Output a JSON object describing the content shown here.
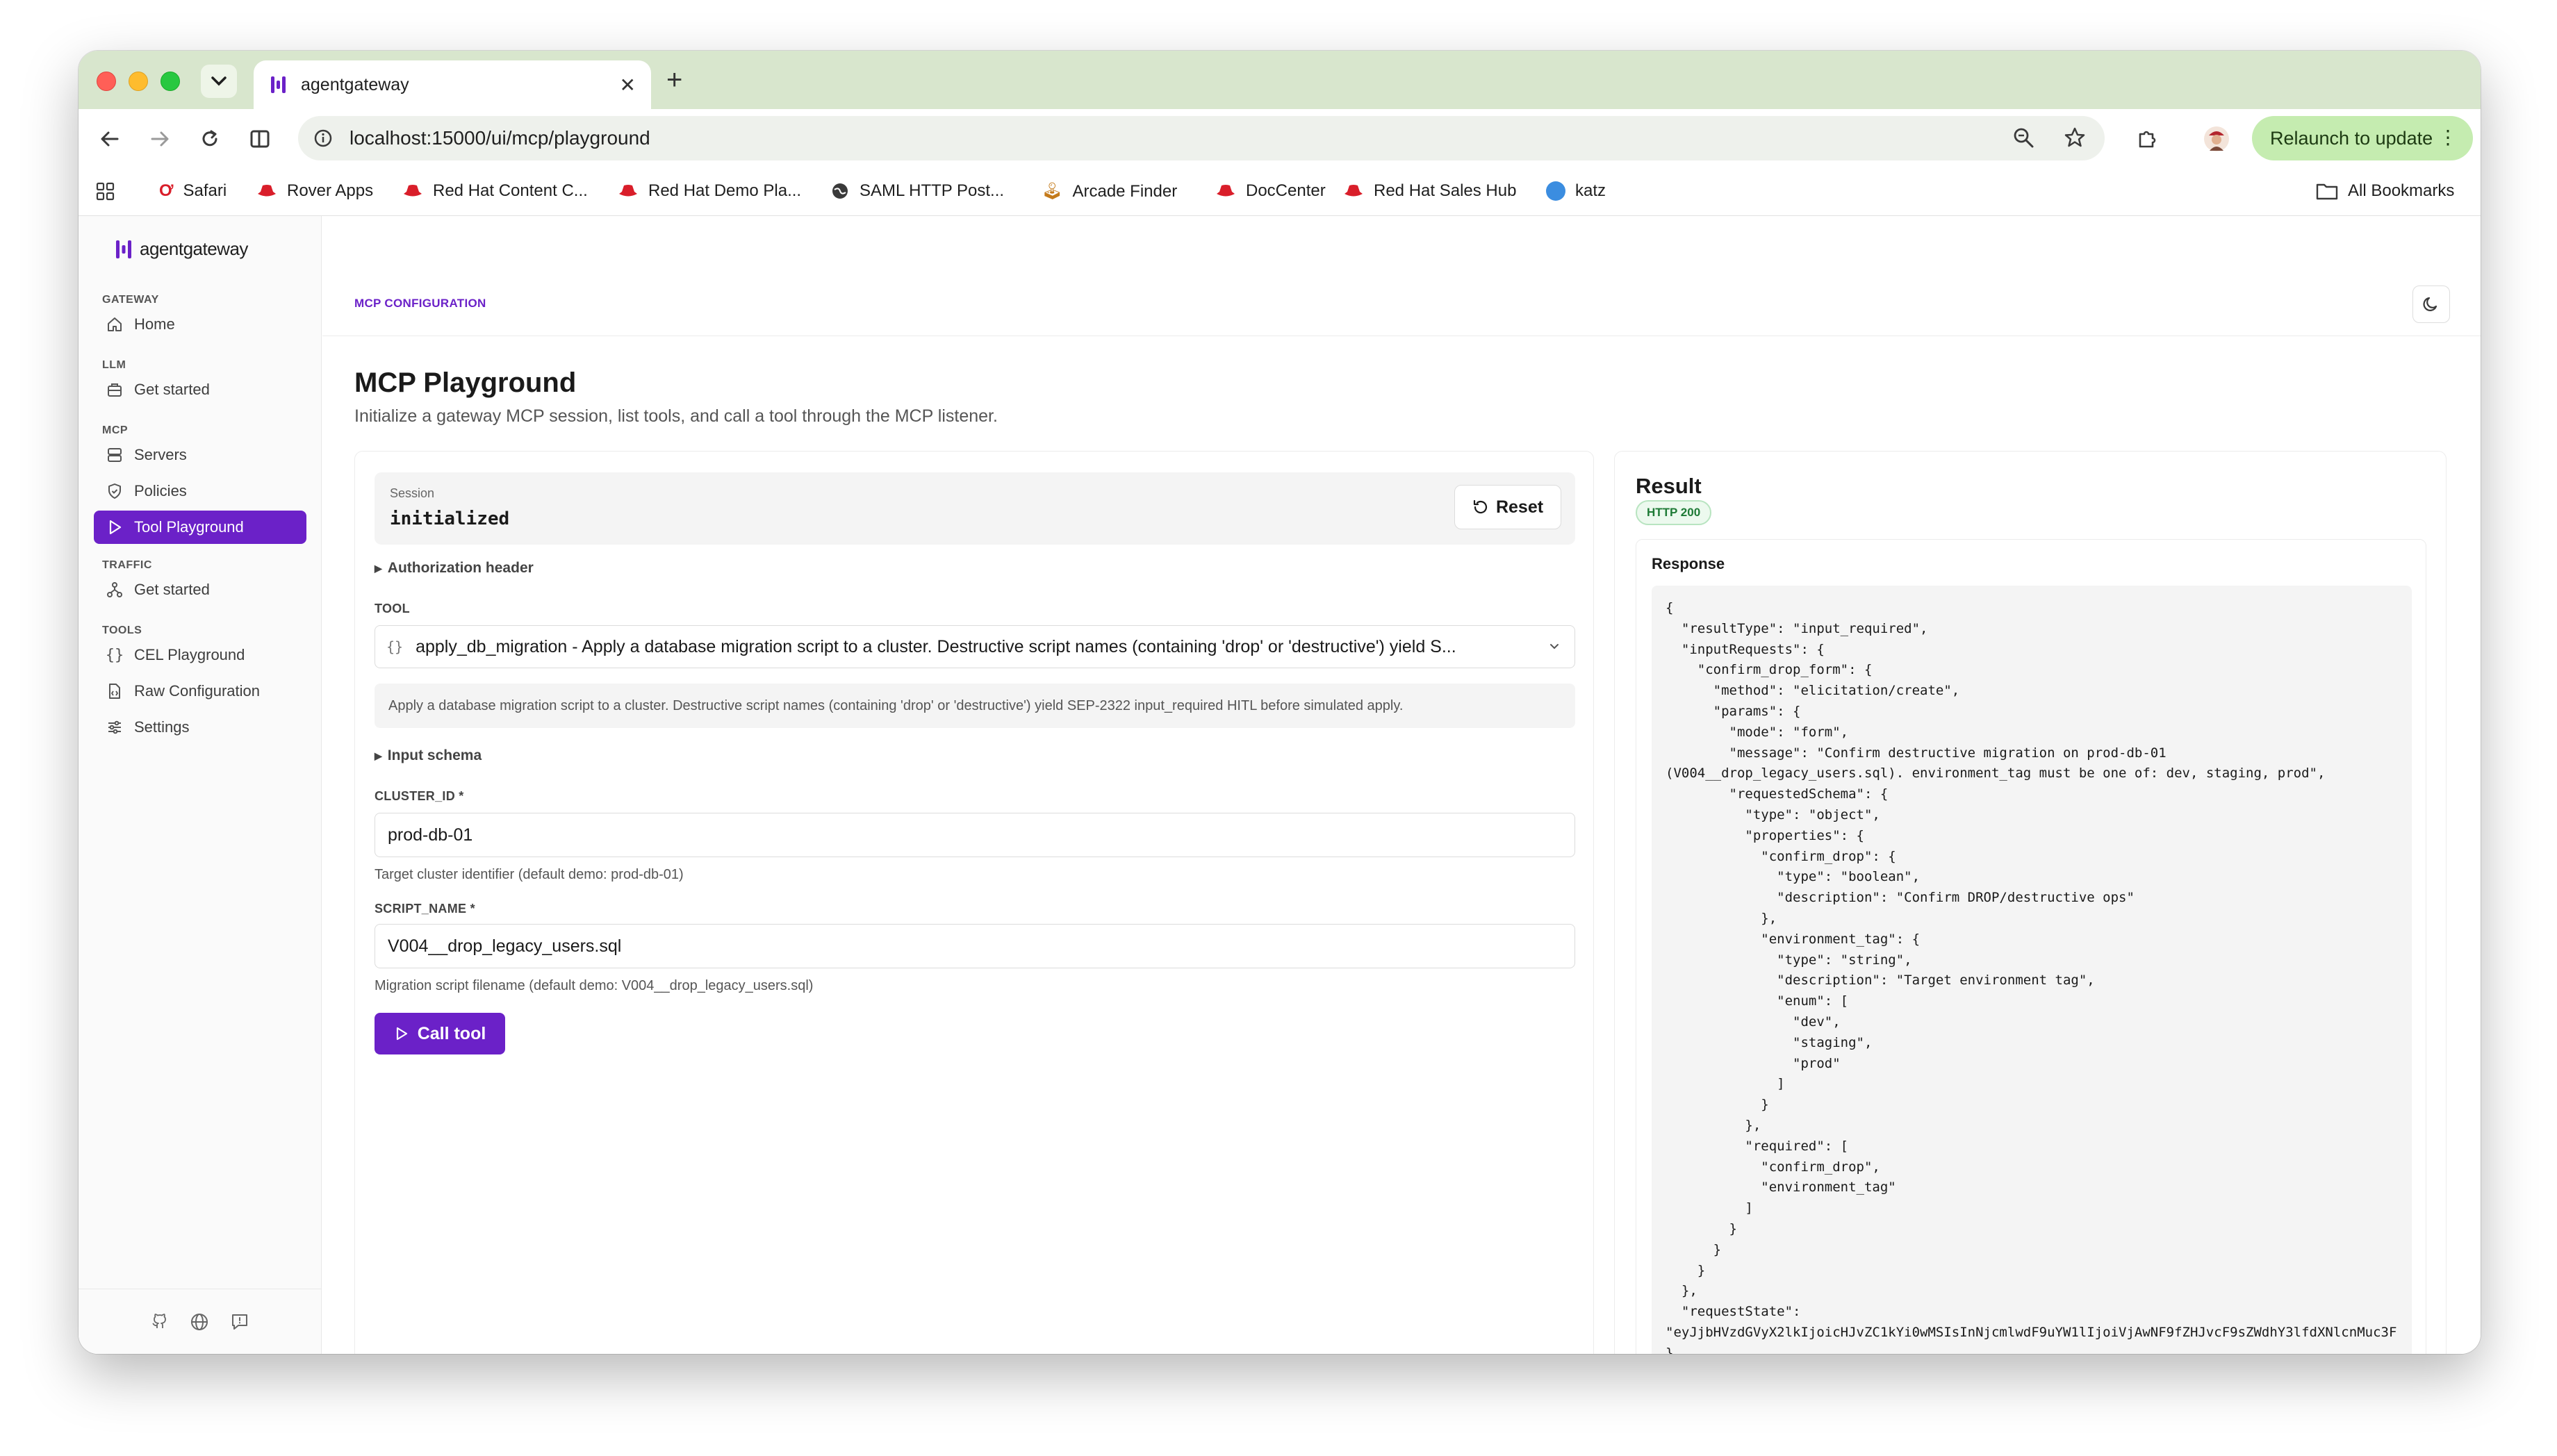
{
  "browser": {
    "tab_title": "agentgateway",
    "url": "localhost:15000/ui/mcp/playground",
    "relaunch_label": "Relaunch to update",
    "bookmarks": [
      "Safari",
      "Rover Apps",
      "Red Hat Content C...",
      "Red Hat Demo Pla...",
      "SAML HTTP Post...",
      "Arcade Finder",
      "DocCenter",
      "Red Hat Sales Hub",
      "katz"
    ],
    "all_bookmarks": "All Bookmarks"
  },
  "sidebar": {
    "logo_text": "agentgateway",
    "sections": [
      {
        "title": "GATEWAY",
        "items": [
          {
            "label": "Home",
            "icon": "home-icon"
          }
        ]
      },
      {
        "title": "LLM",
        "items": [
          {
            "label": "Get started",
            "icon": "package-icon"
          }
        ]
      },
      {
        "title": "MCP",
        "items": [
          {
            "label": "Servers",
            "icon": "server-icon"
          },
          {
            "label": "Policies",
            "icon": "shield-icon"
          },
          {
            "label": "Tool Playground",
            "icon": "play-icon",
            "active": true
          }
        ]
      },
      {
        "title": "TRAFFIC",
        "items": [
          {
            "label": "Get started",
            "icon": "network-icon"
          }
        ]
      },
      {
        "title": "TOOLS",
        "items": [
          {
            "label": "CEL Playground",
            "icon": "braces-icon"
          },
          {
            "label": "Raw Configuration",
            "icon": "file-code-icon"
          },
          {
            "label": "Settings",
            "icon": "sliders-icon"
          }
        ]
      }
    ]
  },
  "header": {
    "breadcrumb": "MCP CONFIGURATION"
  },
  "page": {
    "title": "MCP Playground",
    "subtitle": "Initialize a gateway MCP session, list tools, and call a tool through the MCP listener."
  },
  "form": {
    "session_label": "Session",
    "session_value": "initialized",
    "reset_label": "Reset",
    "auth_header_label": "Authorization header",
    "tool_label": "TOOL",
    "tool_selected": "apply_db_migration - Apply a database migration script to a cluster. Destructive script names (containing 'drop' or 'destructive') yield S...",
    "tool_description": "Apply a database migration script to a cluster. Destructive script names (containing 'drop' or 'destructive') yield SEP-2322 input_required HITL before simulated apply.",
    "input_schema_label": "Input schema",
    "cluster_label": "CLUSTER_ID *",
    "cluster_value": "prod-db-01",
    "cluster_help": "Target cluster identifier (default demo: prod-db-01)",
    "script_label": "SCRIPT_NAME *",
    "script_value": "V004__drop_legacy_users.sql",
    "script_help": "Migration script filename (default demo: V004__drop_legacy_users.sql)",
    "call_label": "Call tool"
  },
  "result": {
    "title": "Result",
    "status": "HTTP 200",
    "response_label": "Response",
    "response_body": "{\n  \"resultType\": \"input_required\",\n  \"inputRequests\": {\n    \"confirm_drop_form\": {\n      \"method\": \"elicitation/create\",\n      \"params\": {\n        \"mode\": \"form\",\n        \"message\": \"Confirm destructive migration on prod-db-01\n(V004__drop_legacy_users.sql). environment_tag must be one of: dev, staging, prod\",\n        \"requestedSchema\": {\n          \"type\": \"object\",\n          \"properties\": {\n            \"confirm_drop\": {\n              \"type\": \"boolean\",\n              \"description\": \"Confirm DROP/destructive ops\"\n            },\n            \"environment_tag\": {\n              \"type\": \"string\",\n              \"description\": \"Target environment tag\",\n              \"enum\": [\n                \"dev\",\n                \"staging\",\n                \"prod\"\n              ]\n            }\n          },\n          \"required\": [\n            \"confirm_drop\",\n            \"environment_tag\"\n          ]\n        }\n      }\n    }\n  },\n  \"requestState\":\n\"eyJjbHVzdGVyX2lkIjoicHJvZC1kYi0wMSIsInNjcmlwdF9uYW1lIjoiVjAwNF9fZHJvcF9sZWdhY3lfdXNlcnMuc3F\n}"
  },
  "colors": {
    "accent": "#6b21c8",
    "tabstrip": "#d8e6cd",
    "relaunch": "#c5ecb0",
    "success": "#1e7a36"
  }
}
